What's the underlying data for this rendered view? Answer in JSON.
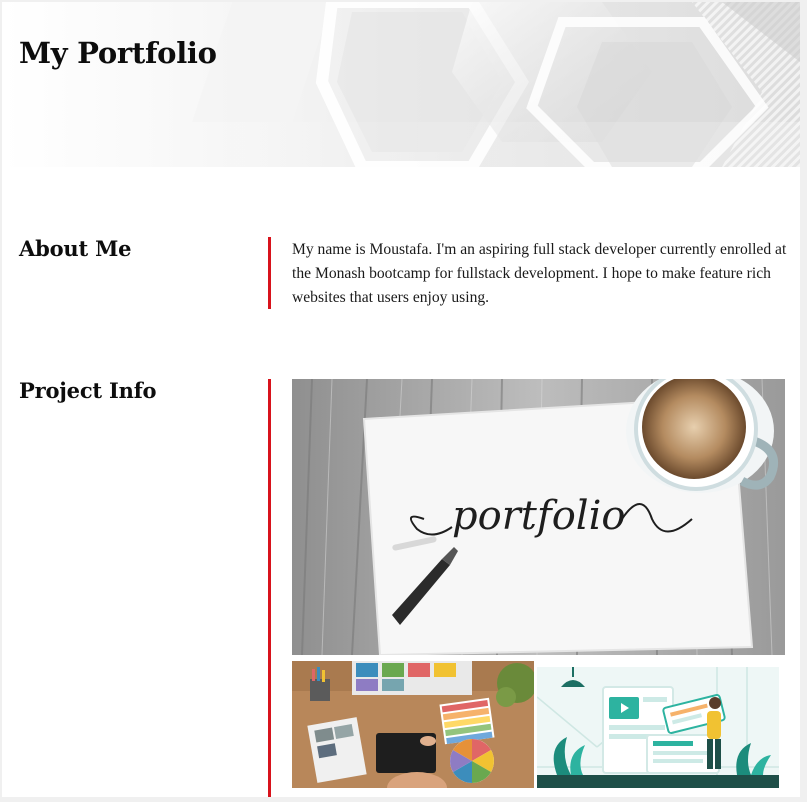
{
  "header": {
    "title": "My Portfolio"
  },
  "about": {
    "heading": "About Me",
    "text": "My name is Moustafa. I'm an aspiring full stack developer currently enrolled at the Monash bootcamp for fullstack development. I hope to make feature rich websites that users enjoy using."
  },
  "projects": {
    "heading": "Project Info",
    "featured_image_text": "portfolio",
    "images": [
      {
        "name": "portfolio-photo"
      },
      {
        "name": "design-desk-photo"
      },
      {
        "name": "web-design-illustration"
      }
    ]
  },
  "colors": {
    "accent": "#d8131c",
    "teal": "#2db3a0"
  }
}
